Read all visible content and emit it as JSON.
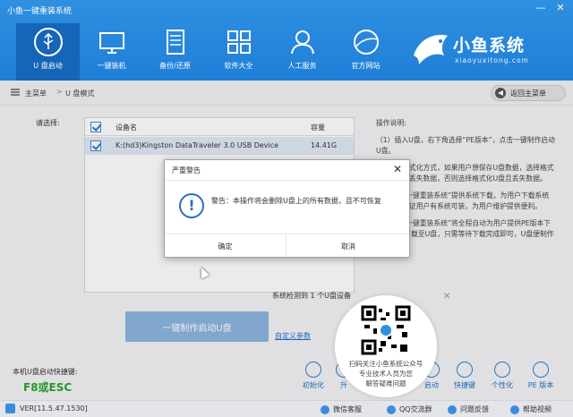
{
  "window": {
    "title": "小鱼一键重装系统",
    "minimize": "—",
    "close": "✕"
  },
  "nav": [
    {
      "label": "U 盘启动",
      "icon": "usb-icon",
      "active": true
    },
    {
      "label": "一键装机",
      "icon": "monitor-icon",
      "active": false
    },
    {
      "label": "备份/还原",
      "icon": "backup-icon",
      "active": false
    },
    {
      "label": "软件大全",
      "icon": "apps-grid-icon",
      "active": false
    },
    {
      "label": "人工服务",
      "icon": "support-person-icon",
      "active": false
    },
    {
      "label": "官方网站",
      "icon": "globe-icon",
      "active": false
    }
  ],
  "logo": {
    "title": "小鱼系统",
    "subtitle": "xiaoyuxitong.com"
  },
  "breadcrumb": {
    "home": "主菜单",
    "sep": ">",
    "current": "U 盘模式",
    "back": "返回主菜单"
  },
  "device": {
    "select_label": "请选择:",
    "col_device": "设备名",
    "col_size": "容量",
    "rows": [
      {
        "name": "K:(hd3)Kingston DataTraveler 3.0 USB Device",
        "size": "14.41G"
      }
    ],
    "detected": "系统检测到 1 个U盘设备"
  },
  "instructions": {
    "title": "操作说明:",
    "p1": "（1）插入U盘，右下角选择“PE版本”，点击一键制作启动U盘。",
    "p2": "(2) 选择格式化方式，如果用户想保存U盘数据，选择格式化U盘且不丢失数据，否则选择格式化U盘且丢失数据。",
    "p3": "(3) “小鱼一键重装系统”提供系统下载，为用户下载系统至U盘，保证用户有系统可装，为用户维护提供便利。",
    "p4": "(4) “小鱼一键重装系统”将全程自动为用户提供PE版本下载及系统下载至U盘，只需等待下载完成即可，U盘便制作完成。"
  },
  "actions": {
    "make_button": "一键制作启动U盘",
    "custom_params": "自定义参数"
  },
  "hotkey": {
    "label": "本机U盘启动快捷键:",
    "value": "F8或ESC"
  },
  "tools": [
    {
      "label": "初始化",
      "icon": "check-circle-icon"
    },
    {
      "label": "升",
      "icon": "upgrade-icon"
    },
    {
      "label": "启动",
      "icon": "boot-icon"
    },
    {
      "label": "快捷键",
      "icon": "mouse-icon"
    },
    {
      "label": "个性化",
      "icon": "palette-icon"
    },
    {
      "label": "PE 版本",
      "icon": "pe-icon"
    }
  ],
  "footer": {
    "version": "VER[11.5.47.1530]",
    "wechat": "微信客服",
    "qq": "QQ交流群",
    "feedback": "问题反馈",
    "help": "帮助视频"
  },
  "dialog": {
    "title": "严重警告",
    "close": "✕",
    "message": "警告：本操作将会删除U盘上的所有数据，且不可恢复",
    "ok": "确定",
    "cancel": "取消"
  },
  "qr": {
    "line1": "扫码关注小鱼系统公众号",
    "line2": "专业技术人员为您",
    "line3": "解答疑难问题",
    "close": "✕"
  },
  "colors": {
    "brand": "#1f7fd8",
    "nav_active": "#1566b8",
    "hotkey": "#29a329",
    "button": "#8db6e0"
  }
}
